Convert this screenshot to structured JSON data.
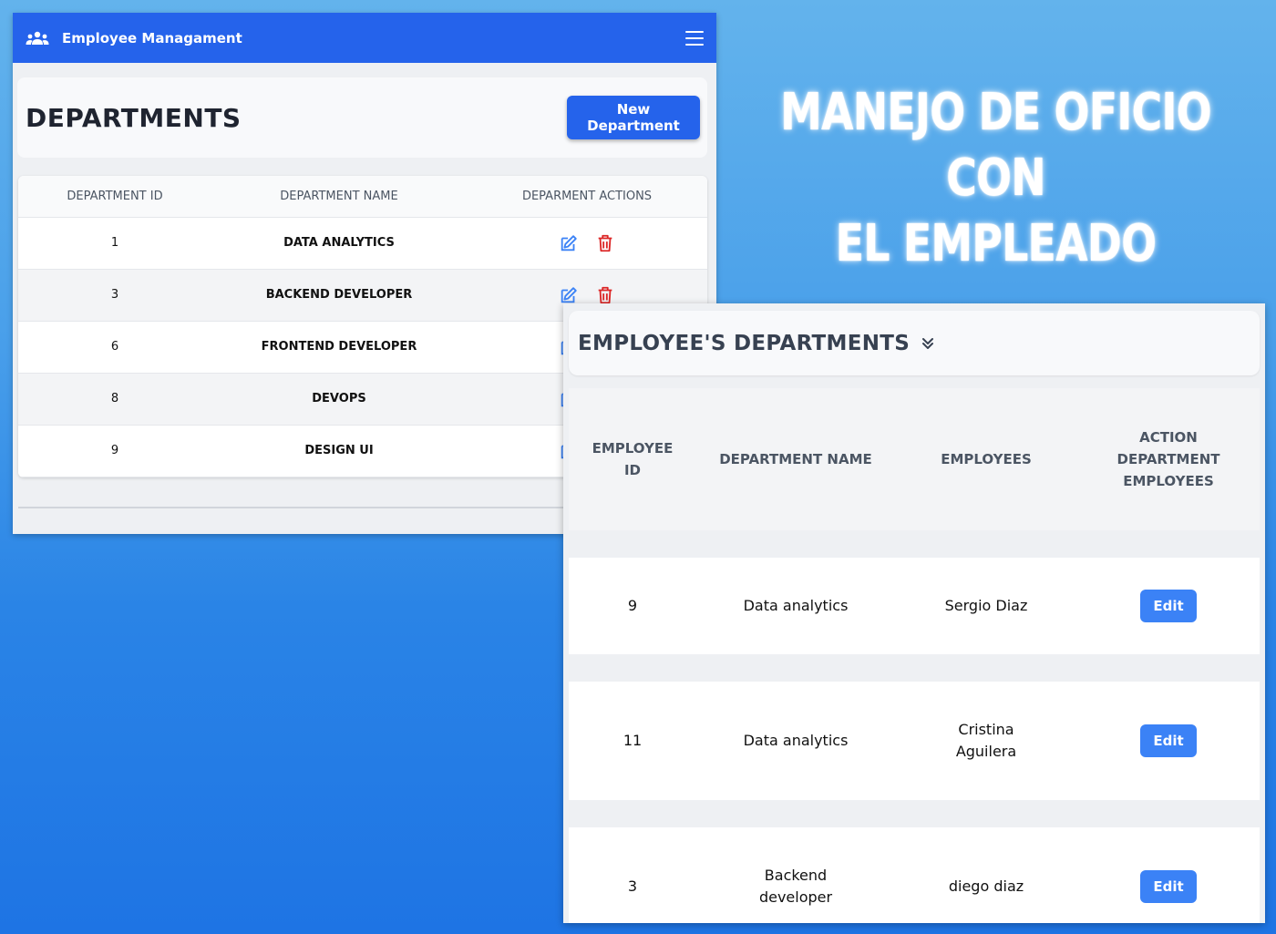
{
  "app": {
    "brand": "Employee Managament",
    "brand_icon": "users-icon",
    "menu_icon": "hamburger-menu-icon"
  },
  "departments": {
    "title": "DEPARTMENTS",
    "new_button": "New Department",
    "columns": [
      "DEPARTMENT ID",
      "DEPARTMENT NAME",
      "DEPARMENT ACTIONS"
    ],
    "rows": [
      {
        "id": "1",
        "name": "DATA ANALYTICS"
      },
      {
        "id": "3",
        "name": "BACKEND DEVELOPER"
      },
      {
        "id": "6",
        "name": "FRONTEND DEVELOPER"
      },
      {
        "id": "8",
        "name": "DEVOPS"
      },
      {
        "id": "9",
        "name": "DESIGN UI"
      }
    ],
    "edit_icon": "edit-icon",
    "delete_icon": "trash-icon",
    "colors": {
      "primary": "#2563eb",
      "edit": "#3b82f6",
      "delete": "#dc2626"
    }
  },
  "hero": {
    "line1": "MANEJO DE OFICIO CON",
    "line2": "EL EMPLEADO"
  },
  "employee_departments": {
    "title": "EMPLOYEE'S DEPARTMENTS",
    "toggle_icon": "chevron-double-down-icon",
    "columns": {
      "id_line1": "EMPLOYEE",
      "id_line2": "ID",
      "dept_name": "DEPARTMENT NAME",
      "employees": "EMPLOYEES",
      "action_line1": "ACTION",
      "action_line2": "DEPARTMENT",
      "action_line3": "EMPLOYEES"
    },
    "rows": [
      {
        "id": "9",
        "dept_line1": "Data analytics",
        "dept_line2": "",
        "emp_line1": "Sergio Diaz",
        "emp_line2": "",
        "action": "Edit"
      },
      {
        "id": "11",
        "dept_line1": "Data analytics",
        "dept_line2": "",
        "emp_line1": "Cristina",
        "emp_line2": "Aguilera",
        "action": "Edit"
      },
      {
        "id": "3",
        "dept_line1": "Backend",
        "dept_line2": "developer",
        "emp_line1": "diego diaz",
        "emp_line2": "",
        "action": "Edit"
      }
    ]
  }
}
